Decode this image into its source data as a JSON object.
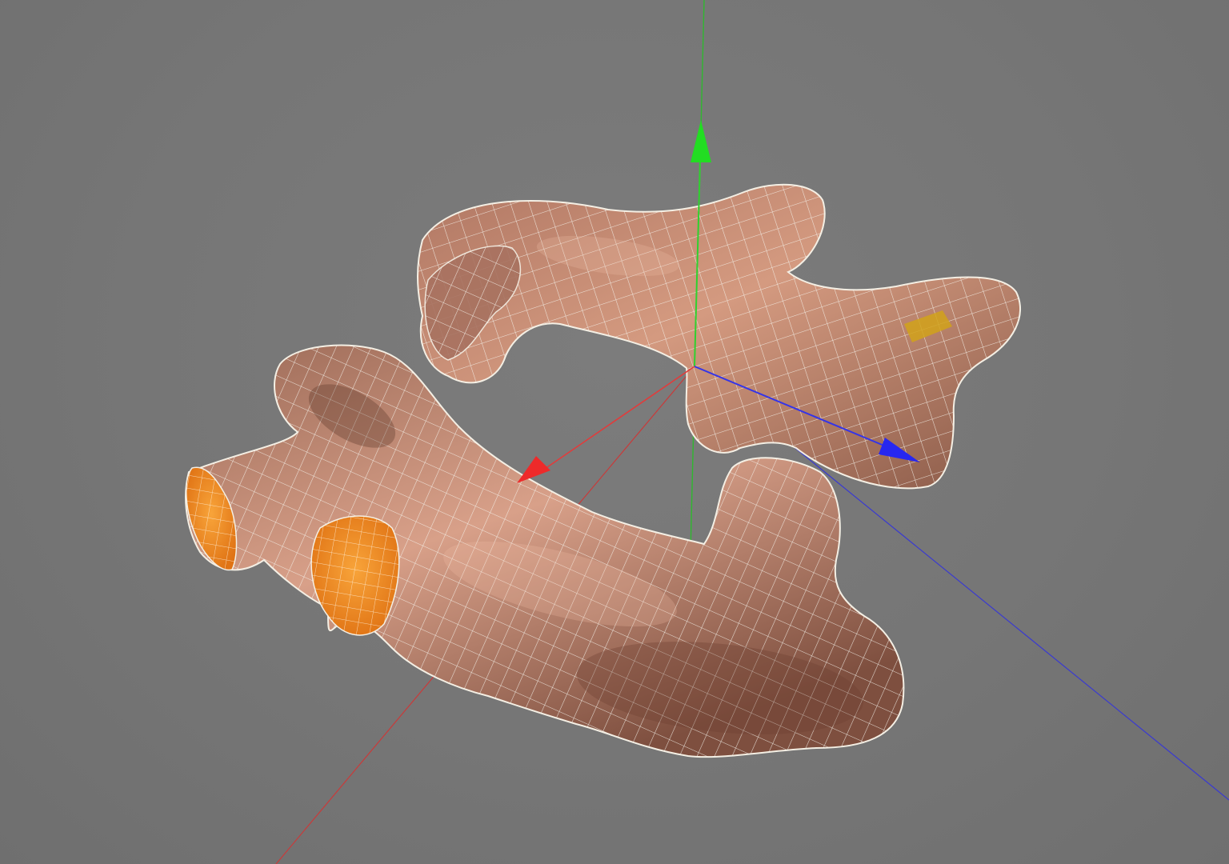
{
  "viewport": {
    "background": "#767676",
    "axis_colors": {
      "x": "#e23b3b",
      "y": "#2fd12f",
      "z": "#3434e8"
    },
    "model": {
      "name": "",
      "skin_color": "#c98a6e",
      "wire_color": "#f4f1ea",
      "cut_face_color": "#f08a1f"
    }
  }
}
